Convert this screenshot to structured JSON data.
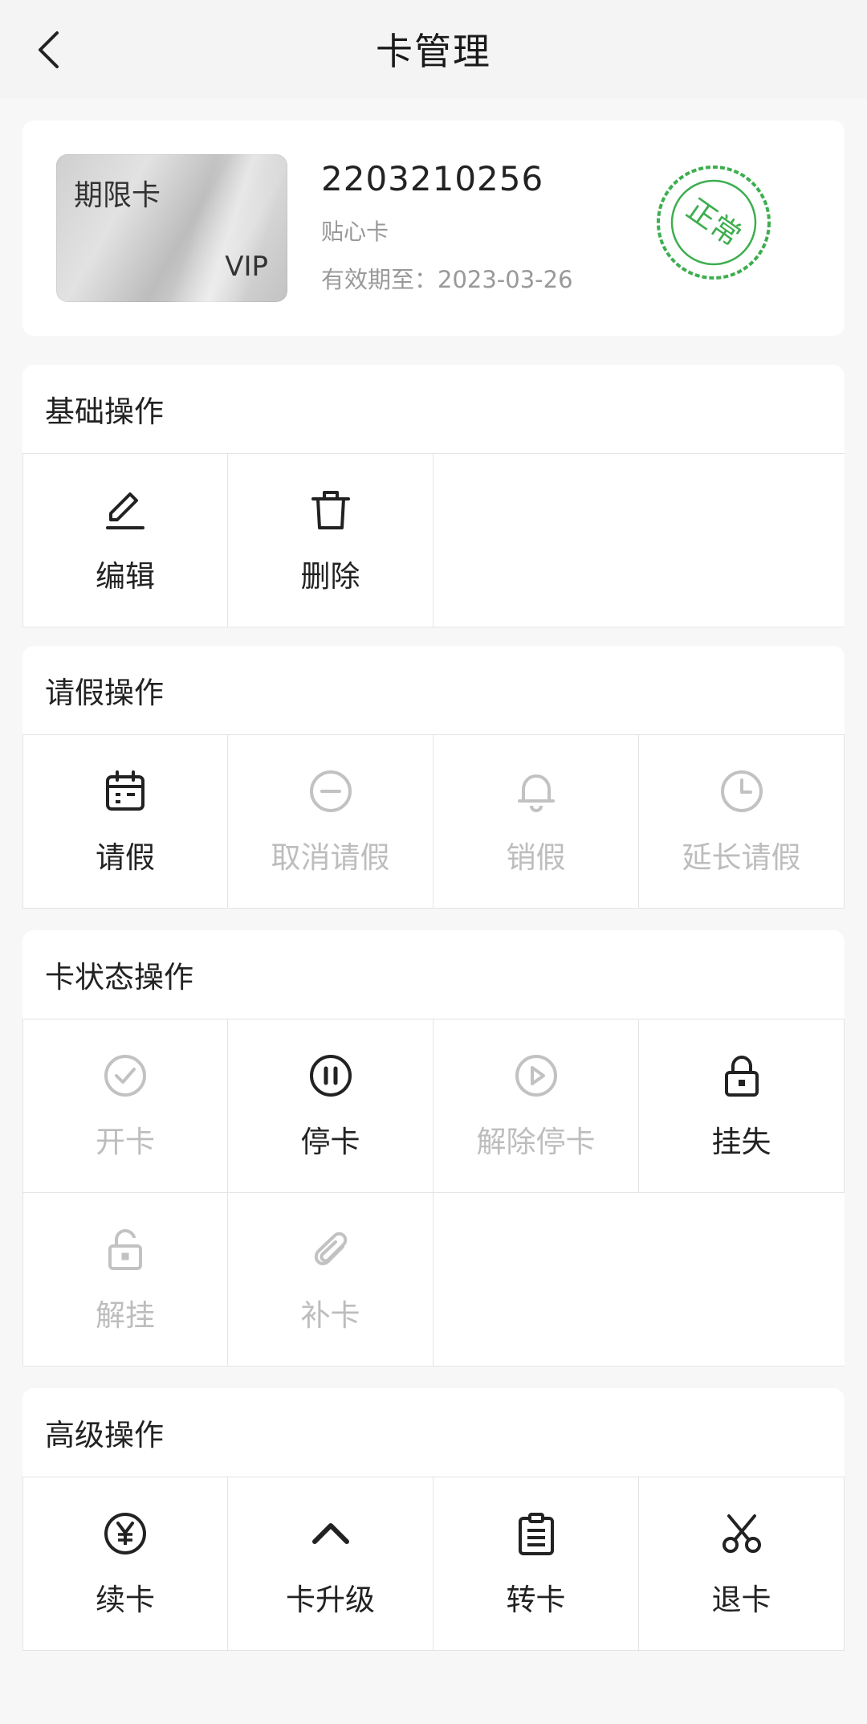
{
  "nav": {
    "title": "卡管理",
    "back_icon": "chevron-left-icon"
  },
  "card": {
    "type_label": "期限卡",
    "vip_label": "VIP",
    "number": "2203210256",
    "name": "贴心卡",
    "expiry": "有效期至：2023-03-26",
    "stamp_text": "正常",
    "stamp_color": "#3dae4f"
  },
  "sections": {
    "basic": {
      "title": "基础操作",
      "items": [
        {
          "label": "编辑",
          "icon": "pencil-icon",
          "enabled": true
        },
        {
          "label": "删除",
          "icon": "trash-icon",
          "enabled": true
        }
      ]
    },
    "leave": {
      "title": "请假操作",
      "items": [
        {
          "label": "请假",
          "icon": "calendar-icon",
          "enabled": true
        },
        {
          "label": "取消请假",
          "icon": "minus-circle-icon",
          "enabled": false
        },
        {
          "label": "销假",
          "icon": "bell-icon",
          "enabled": false
        },
        {
          "label": "延长请假",
          "icon": "clock-icon",
          "enabled": false
        }
      ]
    },
    "status": {
      "title": "卡状态操作",
      "items": [
        {
          "label": "开卡",
          "icon": "check-circle-icon",
          "enabled": false
        },
        {
          "label": "停卡",
          "icon": "pause-circle-icon",
          "enabled": true
        },
        {
          "label": "解除停卡",
          "icon": "play-circle-icon",
          "enabled": false
        },
        {
          "label": "挂失",
          "icon": "lock-icon",
          "enabled": true
        },
        {
          "label": "解挂",
          "icon": "unlock-icon",
          "enabled": false
        },
        {
          "label": "补卡",
          "icon": "paperclip-icon",
          "enabled": false
        }
      ]
    },
    "advanced": {
      "title": "高级操作",
      "items": [
        {
          "label": "续卡",
          "icon": "yen-circle-icon",
          "enabled": true
        },
        {
          "label": "卡升级",
          "icon": "chevron-up-icon",
          "enabled": true
        },
        {
          "label": "转卡",
          "icon": "clipboard-icon",
          "enabled": true
        },
        {
          "label": "退卡",
          "icon": "scissors-icon",
          "enabled": true
        }
      ]
    }
  }
}
